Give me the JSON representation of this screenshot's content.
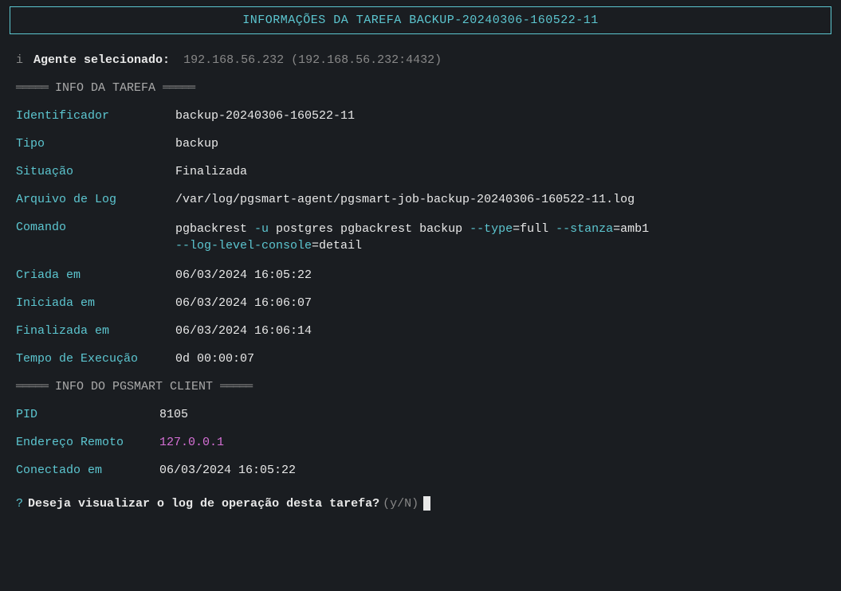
{
  "header": {
    "title": "INFORMAÇÕES DA TAREFA BACKUP-20240306-160522-11"
  },
  "agent": {
    "info_icon": "i",
    "label": "Agente selecionado:",
    "value": "192.168.56.232 (192.168.56.232:4432)"
  },
  "sections": {
    "task_info": {
      "dashes_left": "═════",
      "label": "INFO DA TAREFA",
      "dashes_right": "═════"
    },
    "client_info": {
      "dashes_left": "═════",
      "label": "INFO DO PGSMART CLIENT",
      "dashes_right": "═════"
    }
  },
  "task": {
    "identificador": {
      "key": "Identificador",
      "value": "backup-20240306-160522-11"
    },
    "tipo": {
      "key": "Tipo",
      "value": "backup"
    },
    "situacao": {
      "key": "Situação",
      "value": "Finalizada"
    },
    "arquivo_log": {
      "key": "Arquivo de Log",
      "value": "/var/log/pgsmart-agent/pgsmart-job-backup-20240306-160522-11.log"
    },
    "comando": {
      "key": "Comando",
      "part1": "pgbackrest ",
      "flag1": "-u",
      "part2": " postgres pgbackrest backup ",
      "flag2": "--type",
      "part3": "=full ",
      "flag3": "--stanza",
      "part4": "=amb1 ",
      "flag4": "--log-level-console",
      "part5": "=detail"
    },
    "criada_em": {
      "key": "Criada em",
      "value": "06/03/2024 16:05:22"
    },
    "iniciada_em": {
      "key": "Iniciada em",
      "value": "06/03/2024 16:06:07"
    },
    "finalizada_em": {
      "key": "Finalizada em",
      "value": "06/03/2024 16:06:14"
    },
    "tempo_execucao": {
      "key": "Tempo de Execução",
      "value": "0d 00:00:07"
    }
  },
  "client": {
    "pid": {
      "key": "PID",
      "value": "8105"
    },
    "endereco_remoto": {
      "key": "Endereço Remoto",
      "value": "127.0.0.1"
    },
    "conectado_em": {
      "key": "Conectado em",
      "value": "06/03/2024 16:05:22"
    }
  },
  "prompt": {
    "question_mark": "?",
    "text": "Deseja visualizar o log de operação desta tarefa?",
    "hint": "(y/N)"
  }
}
